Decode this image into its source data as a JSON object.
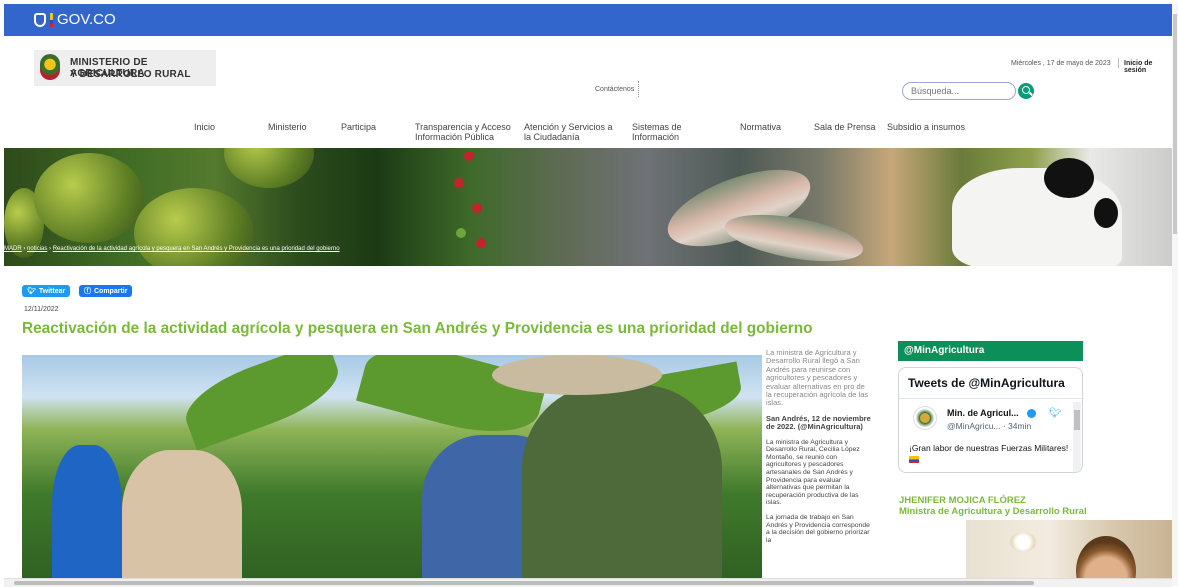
{
  "gov_bar": {
    "logo_text": "GOV.CO"
  },
  "header": {
    "ministry_line1": "MINISTERIO DE AGRICULTURA",
    "ministry_line2": "Y DESARROLLO RURAL",
    "date": "Miércoles , 17 de mayo de 2023",
    "login": "Inicio de sesión",
    "contact": "Contáctenos",
    "search_placeholder": "Búsqueda..."
  },
  "nav": {
    "items": [
      {
        "label": "Inicio"
      },
      {
        "label": "Ministerio"
      },
      {
        "label": "Participa"
      },
      {
        "label": "Transparencia y Acceso",
        "label2": "Información Pública"
      },
      {
        "label": "Atención y Servicios a",
        "label2": "la Ciudadanía"
      },
      {
        "label": "Sistemas de",
        "label2": "Información"
      },
      {
        "label": "Normativa"
      },
      {
        "label": "Sala de Prensa"
      },
      {
        "label": "Subsidio a insumos"
      }
    ]
  },
  "breadcrumb": {
    "home": "MADR",
    "section": "noticias",
    "current": "Reactivación de la actividad agrícola y pesquera en San Andrés y Providencia es una prioridad del gobierno"
  },
  "share": {
    "twitter": "Twittear",
    "facebook": "Compartir"
  },
  "article": {
    "date": "12/11/2022",
    "title": "Reactivación de la actividad agrícola y pesquera en San Andrés y Providencia es una prioridad del gobierno",
    "summary": "La ministra de Agricultura y Desarrollo Rural llegó a San Andrés para reunirse con agricultores y pescadores y evaluar alternativas en pro de la recuperación agrícola de las islas.",
    "dateline": "San Andrés, 12 de noviembre de 2022. (@MinAgricultura)",
    "body1": "La ministra de Agricultura y Desarrollo Rural, Cecilia López Montaño, se reunió con agricultores y pescadores artesanales de San Andrés y Providencia para evaluar alternativas que permitan la recuperación productiva de las islas.",
    "body2": "La jornada de trabajo en San Andrés y Providencia corresponde a la decisión del gobierno priorizar la"
  },
  "twitter_widget": {
    "header": "@MinAgricultura",
    "title": "Tweets de @MinAgricultura",
    "author": "Min. de Agricul...",
    "handle": "@MinAgricu... · 34min",
    "text": "¡Gran labor de nuestras Fuerzas Militares!"
  },
  "minister": {
    "name": "JHENIFER MOJICA FLÓREZ",
    "role": "Ministra de Agricultura y Desarrollo Rural"
  },
  "colors": {
    "gov_blue": "#3366cc",
    "brand_green": "#7aba3a",
    "twitter_blue": "#1d9bf0",
    "facebook_blue": "#1877f2",
    "widget_green": "#0d8f5a"
  }
}
